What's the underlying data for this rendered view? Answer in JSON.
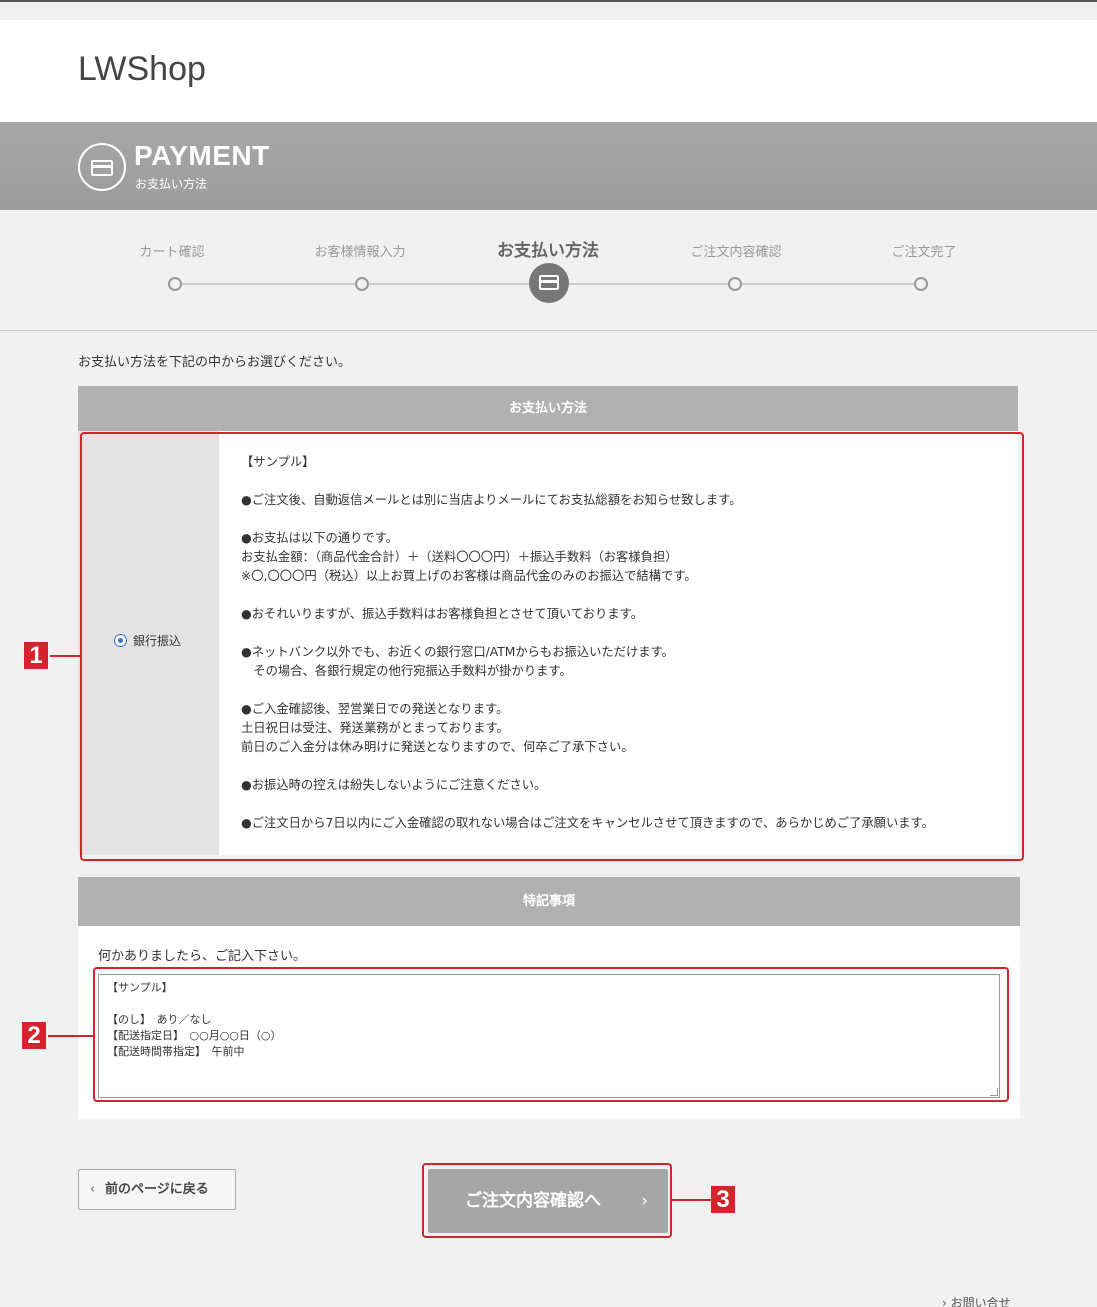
{
  "site": {
    "logo": "LWShop"
  },
  "banner": {
    "title": "PAYMENT",
    "subtitle": "お支払い方法"
  },
  "steps": [
    {
      "label": "カート確認"
    },
    {
      "label": "お客様情報入力"
    },
    {
      "label": "お支払い方法",
      "active": true
    },
    {
      "label": "ご注文内容確認"
    },
    {
      "label": "ご注文完了"
    }
  ],
  "intro": "お支払い方法を下記の中からお選びください。",
  "payment_table": {
    "header": "お支払い方法",
    "option_label": "銀行振込",
    "description": [
      "【サンプル】",
      "●ご注文後、自動返信メールとは別に当店よりメールにてお支払総額をお知らせ致します。",
      "●お支払は以下の通りです。",
      "お支払金額：（商品代金合計）＋（送料〇〇〇円）＋振込手数料（お客様負担）",
      "※〇,〇〇〇円（税込）以上お買上げのお客様は商品代金のみのお振込で結構です。",
      "●おそれいりますが、振込手数料はお客様負担とさせて頂いております。",
      "●ネットバンク以外でも、お近くの銀行窓口/ATMからもお振込いただけます。",
      "　その場合、各銀行規定の他行宛振込手数料が掛かります。",
      "●ご入金確認後、翌営業日での発送となります。",
      "土日祝日は受注、発送業務がとまっております。",
      "前日のご入金分は休み明けに発送となりますので、何卒ご了承下さい。",
      "●お振込時の控えは紛失しないようにご注意ください。",
      "●ご注文日から7日以内にご入金確認の取れない場合はご注文をキャンセルさせて頂きますので、あらかじめご了承願います。"
    ]
  },
  "notes_table": {
    "header": "特記事項",
    "label": "何かありましたら、ご記入下さい。",
    "textarea_value": "【サンプル】\n\n【のし】　あり／なし\n【配送指定日】　○○月○○日（○）\n【配送時間帯指定】　午前中"
  },
  "buttons": {
    "back": "前のページに戻る",
    "next": "ご注文内容確認へ"
  },
  "markers": [
    "1",
    "2",
    "3"
  ],
  "footer": {
    "contact": "お問い合せ"
  },
  "colors": {
    "highlight": "#d6222c",
    "banner": "#a3a3a3",
    "radio": "#3a74c9"
  }
}
